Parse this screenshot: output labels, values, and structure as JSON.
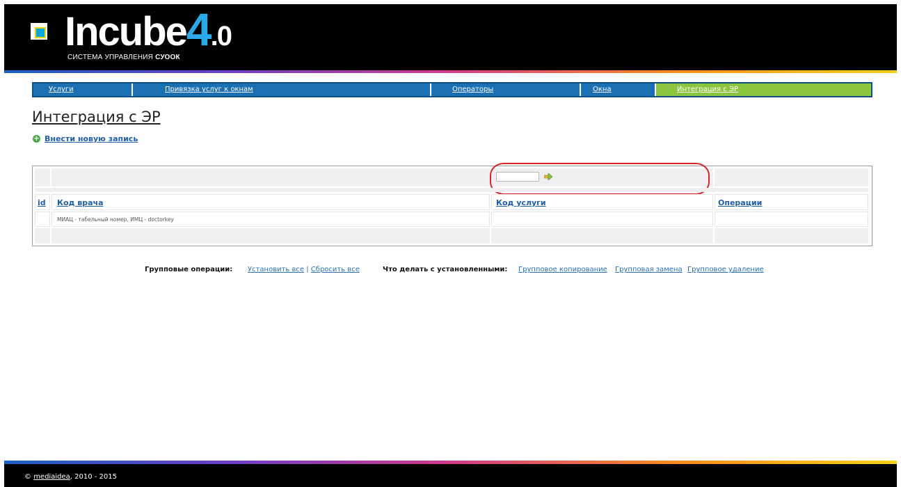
{
  "header": {
    "logo_word": "Incube",
    "logo_version_main": "4",
    "logo_version_sub": ".0",
    "subtitle_prefix": "СИСТЕМА УПРАВЛЕНИЯ",
    "subtitle_brand": "СУООК"
  },
  "nav": {
    "items": [
      {
        "label": "Услуги"
      },
      {
        "label": "Привязка услуг к окнам"
      },
      {
        "label": "Операторы"
      },
      {
        "label": "Окна"
      },
      {
        "label": "Интеграция с ЭР"
      }
    ],
    "active_index": 4
  },
  "page": {
    "title": "Интеграция с ЭР",
    "add_link": "Внести новую запись"
  },
  "table": {
    "columns": [
      "id",
      "Код врача",
      "Код услуги",
      "Операции"
    ],
    "rows": [
      {
        "id": "",
        "doctor_code": "МИАЦ - табельный номер, ИМЦ - doctorkey",
        "service_code": "",
        "operations": ""
      }
    ],
    "filter_value": ""
  },
  "group_ops": {
    "label": "Групповые операции:",
    "set_all": "Установить все",
    "separator": "|",
    "reset_all": "Сбросить все",
    "selected_label": "Что делать с установленными:",
    "copy": "Групповое копирование",
    "replace": "Групповая замена",
    "delete": "Групповое удаление"
  },
  "footer": {
    "copyright": "©",
    "company": "mediaidea",
    "years": ", 2010 - 2015"
  },
  "colors": {
    "nav_bg": "#1a70b3",
    "nav_active": "#8cc63f",
    "link": "#1f5fa6",
    "annotation": "#d9232a"
  }
}
